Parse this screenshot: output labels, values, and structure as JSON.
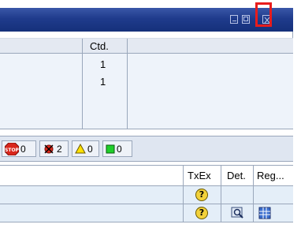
{
  "window": {
    "icons": [
      "minimize-icon",
      "maximize-icon",
      "close-icon"
    ],
    "highlight_color": "#e81c1c"
  },
  "upper_table": {
    "column_header": "Ctd.",
    "rows": [
      "1",
      "1"
    ]
  },
  "status_bar": {
    "stop_count": "0",
    "error_count": "2",
    "warning_count": "0",
    "success_count": "0"
  },
  "lower_table": {
    "headers": {
      "txex": "TxEx",
      "det": "Det.",
      "reg": "Reg..."
    },
    "rows": [
      {
        "txex_icon": "question-icon",
        "det_icon": "",
        "reg_icon": ""
      },
      {
        "txex_icon": "question-icon",
        "det_icon": "magnifier-detail-icon",
        "reg_icon": "grid-icon"
      }
    ]
  },
  "colors": {
    "titlebar": "#1f3b8c",
    "header_bg": "#e4e9f2",
    "row_bg": "#e4eef8",
    "status_bg": "#dfe6f1"
  }
}
